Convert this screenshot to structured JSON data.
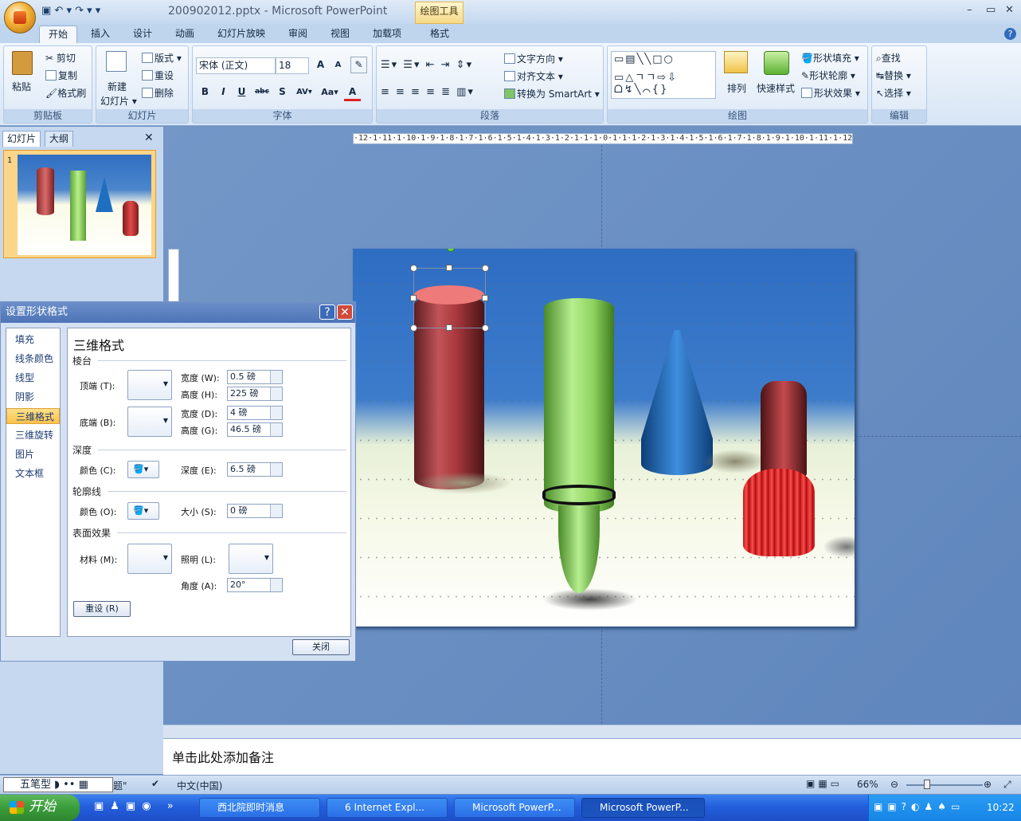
{
  "window": {
    "title": "200902012.pptx - Microsoft PowerPoint",
    "context_tab_group": "绘图工具",
    "qat": "▣ ↶ ▾ ↷ ▾ ▾"
  },
  "tabs": [
    "开始",
    "插入",
    "设计",
    "动画",
    "幻灯片放映",
    "审阅",
    "视图",
    "加载项",
    "格式"
  ],
  "ribbon": {
    "clipboard": {
      "label": "剪贴板",
      "paste": "粘贴",
      "cut": "剪切",
      "copy": "复制",
      "format_painter": "格式刷"
    },
    "slides": {
      "label": "幻灯片",
      "new_slide": "新建",
      "new_slide2": "幻灯片 ▾",
      "layout": "版式 ▾",
      "reset": "重设",
      "delete": "删除"
    },
    "font": {
      "label": "字体",
      "font_name": "宋体 (正文)",
      "font_size": "18",
      "bold": "B",
      "italic": "I",
      "underline": "U",
      "strike": "abc",
      "shadow": "S",
      "spacing": "AV▾",
      "case": "Aa▾",
      "color": "A"
    },
    "paragraph": {
      "label": "段落",
      "text_direction": "文字方向 ▾",
      "align_text": "对齐文本 ▾",
      "smartart": "转换为 SmartArt ▾"
    },
    "drawing": {
      "label": "绘图",
      "arrange": "排列",
      "quick_styles": "快速样式",
      "shape_fill": "形状填充 ▾",
      "shape_outline": "形状轮廓 ▾",
      "shape_effects": "形状效果 ▾",
      "shapes_row1": "▭▤╲╲□○",
      "shapes_row2": "▭△ㄱㄱ⇨⇩",
      "shapes_row3": "ᗝ↯╲⌒{}"
    },
    "editing": {
      "label": "编辑",
      "find": "查找",
      "replace": "替换 ▾",
      "select": "选择 ▾"
    }
  },
  "left_panel": {
    "tab_slides": "幻灯片",
    "tab_outline": "大纲",
    "slide_number": "1"
  },
  "ruler": "·12·1·11·1·10·1·9·1·8·1·7·1·6·1·5·1·4·1·3·1·2·1·1·1·0·1·1·1·2·1·3·1·4·1·5·1·6·1·7·1·8·1·9·1·10·1·11·1·12·",
  "notes_placeholder": "单击此处添加备注",
  "status": {
    "theme": "题\"",
    "language": "中文(中国)",
    "zoom": "66%",
    "ime": "五笔型"
  },
  "dialog": {
    "title": "设置形状格式",
    "nav": [
      "填充",
      "线条颜色",
      "线型",
      "阴影",
      "三维格式",
      "三维旋转",
      "图片",
      "文本框"
    ],
    "selected_nav": "三维格式",
    "heading": "三维格式",
    "bevel": "棱台",
    "top": "顶端 (T):",
    "bottom": "底端 (B):",
    "width1_label": "宽度 (W):",
    "width1": "0.5 磅",
    "height1_label": "高度 (H):",
    "height1": "225 磅",
    "width2_label": "宽度 (D):",
    "width2": "4 磅",
    "height2_label": "高度 (G):",
    "height2": "46.5 磅",
    "depth": "深度",
    "depth_color_label": "颜色 (C):",
    "depth_label": "深度 (E):",
    "depth_value": "6.5 磅",
    "contour": "轮廓线",
    "contour_color_label": "颜色 (O):",
    "size_label": "大小 (S):",
    "size_value": "0 磅",
    "surface": "表面效果",
    "material_label": "材料 (M):",
    "lighting_label": "照明 (L):",
    "angle_label": "角度 (A):",
    "angle_value": "20°",
    "reset": "重设 (R)",
    "close": "关闭"
  },
  "taskbar": {
    "start": "开始",
    "items": [
      "西北院即时消息",
      "6 Internet Expl...",
      "Microsoft PowerP...",
      "Microsoft PowerP..."
    ],
    "clock": "10:22"
  }
}
